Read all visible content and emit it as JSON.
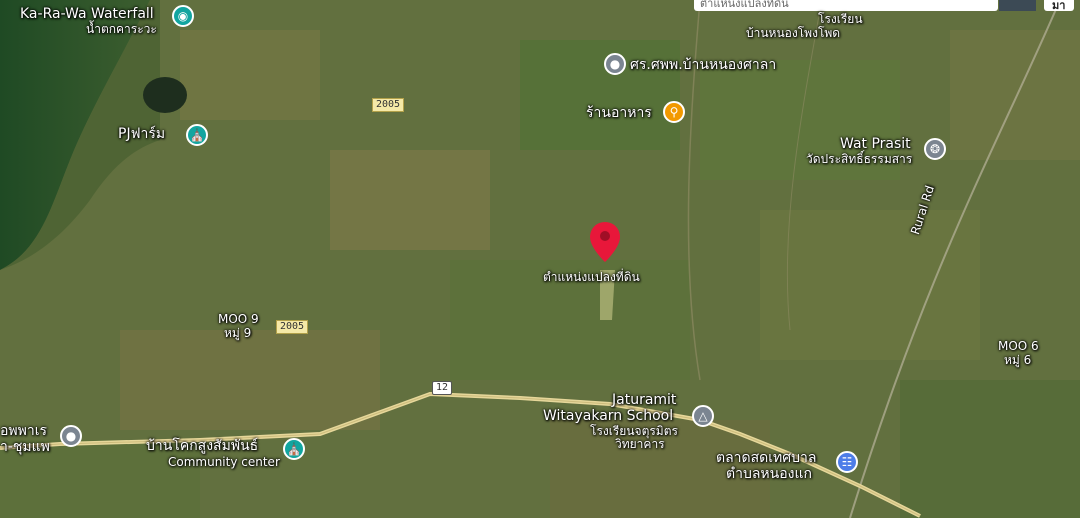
{
  "search": {
    "value": "ตำแหน่งแปลงที่ดิน"
  },
  "map_button_label": "มา",
  "labels": {
    "waterfall": "Ka-Ra-Wa Waterfall",
    "waterfall_th": "น้ำตกคาระวะ",
    "pj_farm": "PJฟาร์ม",
    "health_center": "ศร.ศพพ.บ้านหนองศาลา",
    "restaurant": "ร้านอาหาร",
    "school_top": "โรงเรียน",
    "school_top_sub": "บ้านหนองโพงโพด",
    "wat_prasit": "Wat Prasit",
    "wat_prasit_th": "วัดประสิทธิ์ธรรมสาร",
    "rural_rd": "Rural Rd",
    "land_pin": "ตำแหน่งแปลงที่ดิน",
    "moo9": "MOO 9",
    "moo9_th": "หมู่ 9",
    "moo6": "MOO 6",
    "moo6_th": "หมู่ 6",
    "jaturamit_1": "Jaturamit",
    "jaturamit_2": "Witayakarn School",
    "jaturamit_th1": "โรงเรียนจตุรมิตร",
    "jaturamit_th2": "วิทยาคาร",
    "community_th": "บ้านโคกสูงสัมพันธ์",
    "community_en": "Community center",
    "market_1": "ตลาดสดเทศบาล",
    "market_2": "ตำบลหนองแก",
    "left_edge_1": "อพพาเร",
    "left_edge_2": "า-ชุมแพ"
  },
  "road_shields": {
    "r2005_a": "2005",
    "r2005_b": "2005",
    "r12": "12"
  },
  "colors": {
    "pin_red": "#e8173a",
    "road": "#e6d79a"
  },
  "icons": {
    "waterfall": "camera-icon",
    "pj_farm": "bank-icon",
    "health_center": "location-pin-icon",
    "restaurant": "fork-knife-icon",
    "wat": "dharma-wheel-icon",
    "school": "graduation-cap-icon",
    "community": "community-icon",
    "market": "shopping-cart-icon",
    "land": "red-location-pin-icon"
  }
}
